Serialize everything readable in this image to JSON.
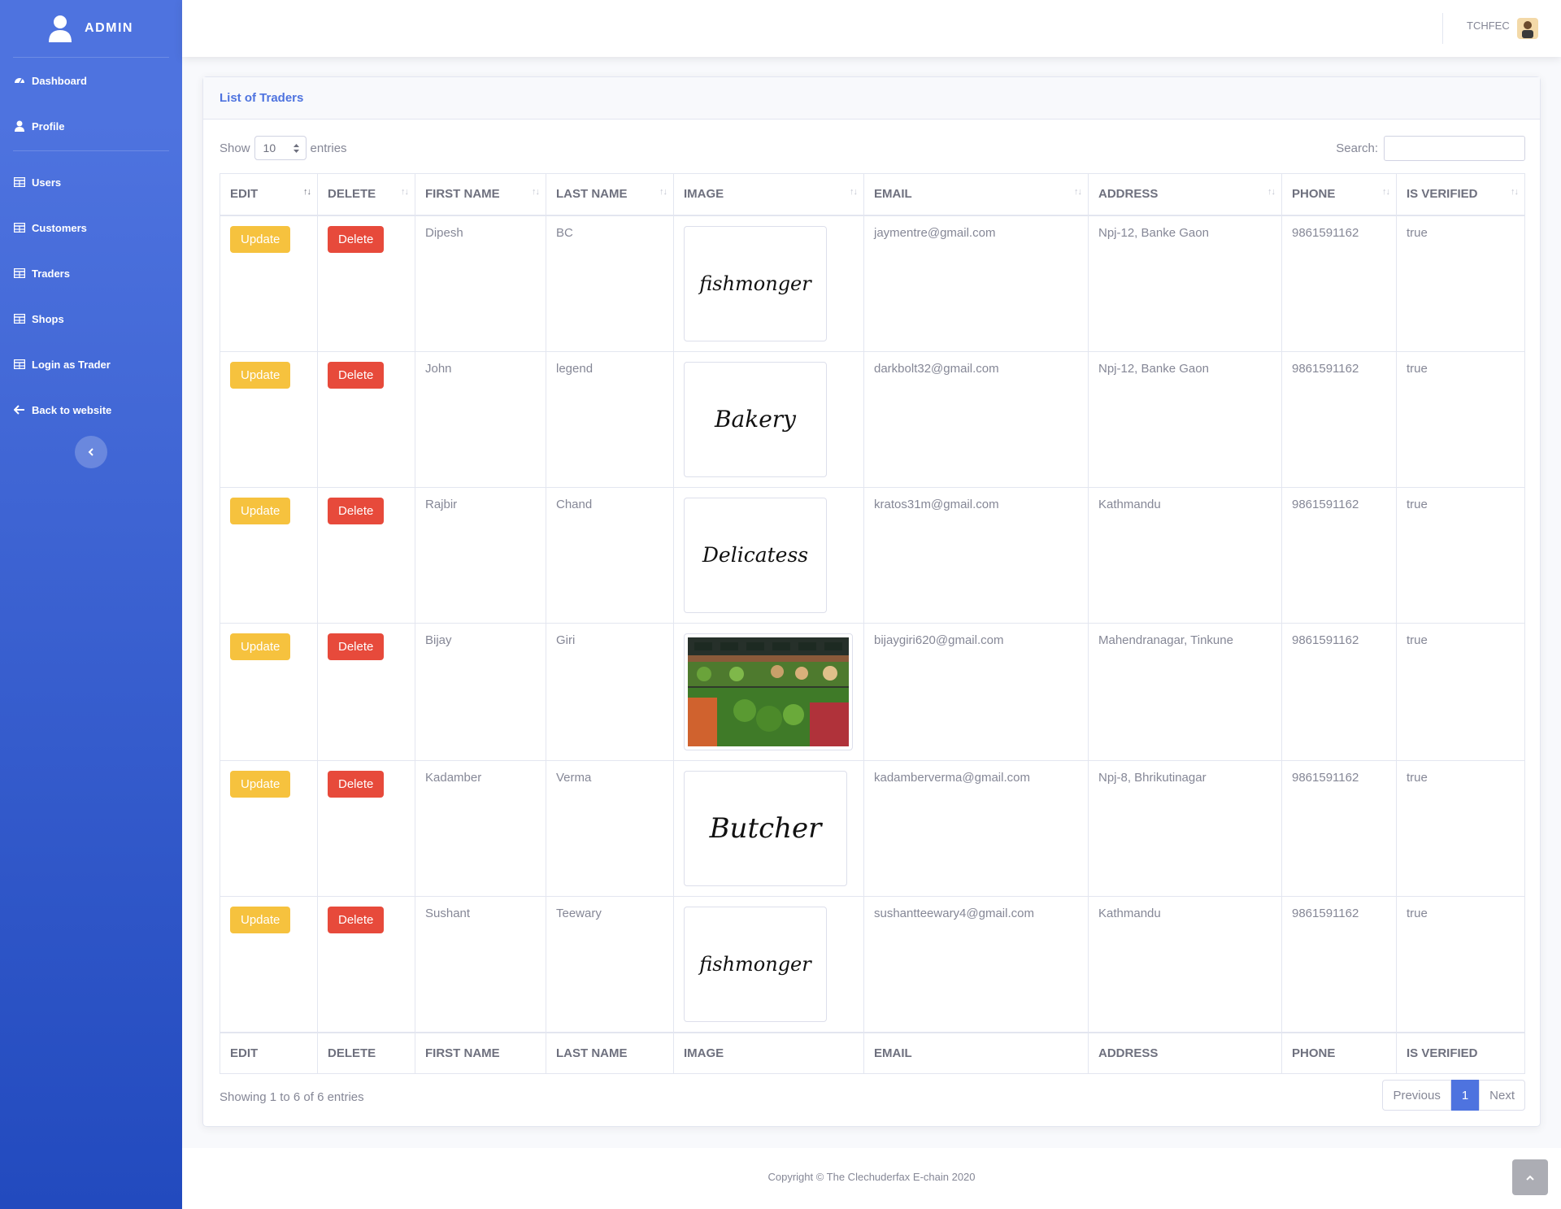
{
  "sidebar": {
    "brand": "ADMIN",
    "items": [
      {
        "label": "Dashboard",
        "icon": "dashboard-icon"
      },
      {
        "label": "Profile",
        "icon": "user-icon"
      },
      {
        "label": "Users",
        "icon": "table-icon"
      },
      {
        "label": "Customers",
        "icon": "table-icon"
      },
      {
        "label": "Traders",
        "icon": "table-icon"
      },
      {
        "label": "Shops",
        "icon": "table-icon"
      },
      {
        "label": "Login as Trader",
        "icon": "table-icon"
      },
      {
        "label": "Back to website",
        "icon": "arrow-left-icon"
      }
    ]
  },
  "topbar": {
    "username": "TCHFEC"
  },
  "card": {
    "title": "List of Traders"
  },
  "controls": {
    "show_label": "Show",
    "entries_value": "10",
    "entries_label": "entries",
    "search_label": "Search:",
    "search_value": ""
  },
  "table": {
    "columns": [
      "EDIT",
      "DELETE",
      "FIRST NAME",
      "LAST NAME",
      "IMAGE",
      "EMAIL",
      "ADDRESS",
      "PHONE",
      "IS VERIFIED"
    ],
    "update_label": "Update",
    "delete_label": "Delete",
    "rows": [
      {
        "first": "Dipesh",
        "last": "BC",
        "image_text": "fishmonger",
        "email": "jaymentre@gmail.com",
        "address": "Npj-12, Banke Gaon",
        "phone": "9861591162",
        "verified": "true"
      },
      {
        "first": "John",
        "last": "legend",
        "image_text": "Bakery",
        "email": "darkbolt32@gmail.com",
        "address": "Npj-12, Banke Gaon",
        "phone": "9861591162",
        "verified": "true"
      },
      {
        "first": "Rajbir",
        "last": "Chand",
        "image_text": "Delicatess",
        "email": "kratos31m@gmail.com",
        "address": "Kathmandu",
        "phone": "9861591162",
        "verified": "true"
      },
      {
        "first": "Bijay",
        "last": "Giri",
        "image_text": "",
        "email": "bijaygiri620@gmail.com",
        "address": "Mahendranagar, Tinkune",
        "phone": "9861591162",
        "verified": "true"
      },
      {
        "first": "Kadamber",
        "last": "Verma",
        "image_text": "Butcher",
        "email": "kadamberverma@gmail.com",
        "address": "Npj-8, Bhrikutinagar",
        "phone": "9861591162",
        "verified": "true"
      },
      {
        "first": "Sushant",
        "last": "Teewary",
        "image_text": "fishmonger",
        "email": "sushantteewary4@gmail.com",
        "address": "Kathmandu",
        "phone": "9861591162",
        "verified": "true"
      }
    ]
  },
  "pagination": {
    "info": "Showing 1 to 6 of 6 entries",
    "previous": "Previous",
    "current": "1",
    "next": "Next"
  },
  "footer": {
    "copyright": "Copyright © The Clechuderfax E-chain 2020"
  },
  "colors": {
    "primary": "#4e73df",
    "warning": "#f6c23e",
    "danger": "#e74a3b"
  }
}
